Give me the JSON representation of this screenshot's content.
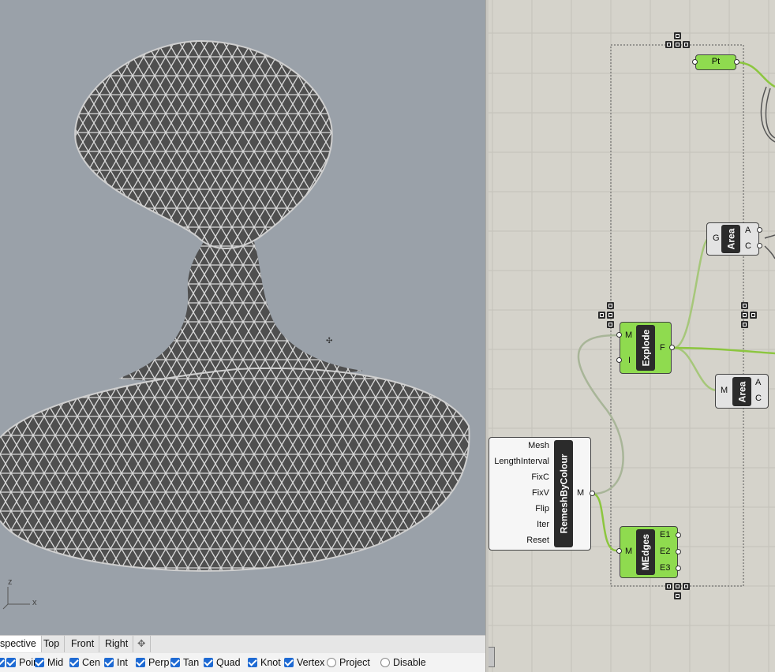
{
  "viewport": {
    "axis_x": "x",
    "axis_z": "z",
    "background": "#9aa1a9",
    "mesh_fill": "#4f4f4f",
    "mesh_line": "#dcdcdc"
  },
  "view_tabs": [
    "spective",
    "Top",
    "Front",
    "Right"
  ],
  "osnaps": [
    {
      "label": "Point",
      "checked": true
    },
    {
      "label": "Mid",
      "checked": true
    },
    {
      "label": "Cen",
      "checked": true
    },
    {
      "label": "Int",
      "checked": true
    },
    {
      "label": "Perp",
      "checked": true
    },
    {
      "label": "Tan",
      "checked": true
    },
    {
      "label": "Quad",
      "checked": true
    },
    {
      "label": "Knot",
      "checked": true
    },
    {
      "label": "Vertex",
      "checked": true
    },
    {
      "label": "Project",
      "checked": false
    },
    {
      "label": "Disable",
      "checked": false
    }
  ],
  "gh": {
    "pt": {
      "label": "Pt"
    },
    "area_top": {
      "nickname": "Area",
      "input": "G",
      "outputs": [
        "A",
        "C"
      ]
    },
    "explode": {
      "nickname": "Explode",
      "inputs": [
        "M",
        "I"
      ],
      "output": "F"
    },
    "area_bottom": {
      "nickname": "Area",
      "input": "M",
      "outputs": [
        "A",
        "C"
      ]
    },
    "remesh": {
      "nickname": "RemeshByColour",
      "inputs": [
        "Mesh",
        "LengthInterval",
        "FixC",
        "FixV",
        "Flip",
        "Iter",
        "Reset"
      ],
      "output": "M"
    },
    "medges": {
      "nickname": "MEdges",
      "input": "M",
      "outputs": [
        "E1",
        "E2",
        "E3"
      ]
    },
    "colors": {
      "wire_green": "#8cc63f",
      "wire_grey": "#a8a8a8",
      "component_green": "#8fdb4f"
    }
  }
}
